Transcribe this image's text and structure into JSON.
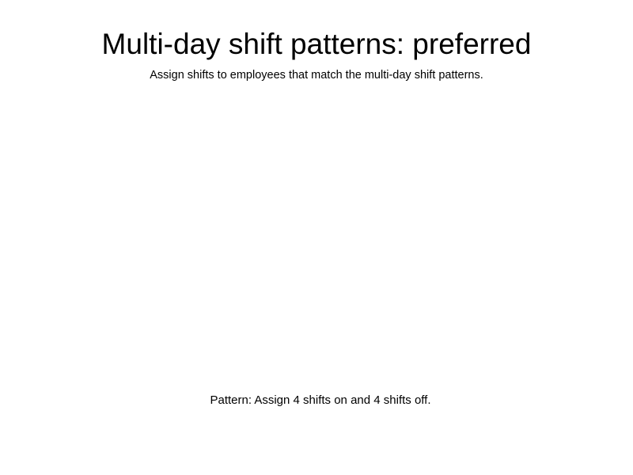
{
  "header": {
    "title": "Multi-day shift patterns: preferred",
    "subtitle": "Assign shifts to employees that match the multi-day shift patterns."
  },
  "main": {
    "pattern_text": "Pattern: Assign 4 shifts on and 4 shifts off."
  }
}
